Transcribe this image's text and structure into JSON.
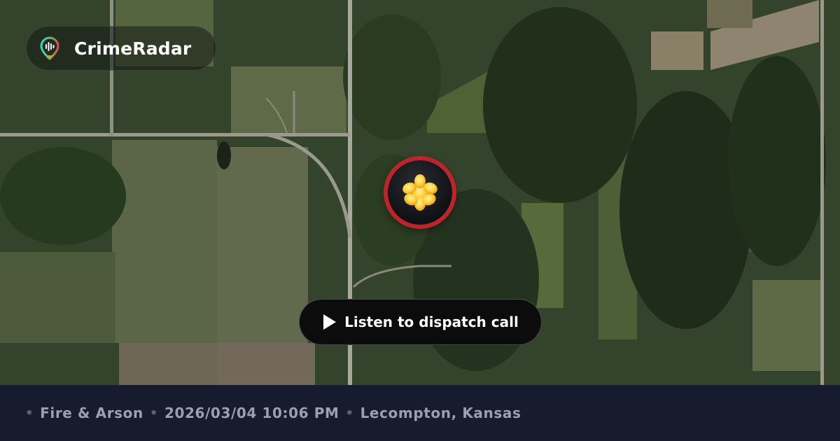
{
  "brand": {
    "name": "CrimeRadar",
    "logo_icon": "radar-pin-icon"
  },
  "map": {
    "style": "satellite",
    "marker_icon": "flame-burst-icon",
    "marker_ring_color": "#c0242b"
  },
  "actions": {
    "listen_label": "Listen to dispatch call",
    "listen_icon": "play-icon"
  },
  "incident": {
    "separator": "•",
    "category": "Fire & Arson",
    "datetime": "2026/03/04 10:06 PM",
    "location": "Lecompton, Kansas"
  },
  "colors": {
    "footer_bg": "#161c2e",
    "footer_text": "#9aa0ae",
    "accent_red": "#c0242b",
    "marker_yellow": "#ffd23a"
  }
}
